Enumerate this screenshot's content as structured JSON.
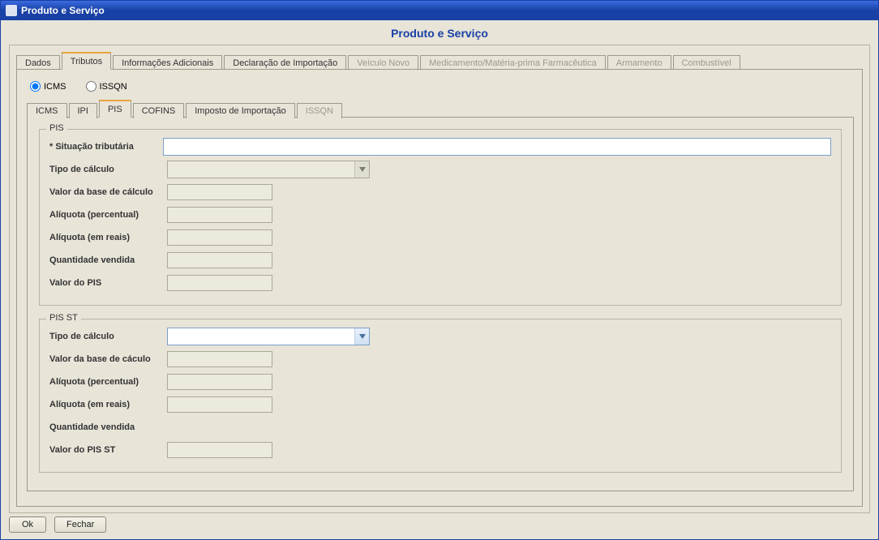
{
  "window": {
    "title": "Produto e Serviço"
  },
  "panel_title": "Produto e Serviço",
  "main_tabs": [
    {
      "label": "Dados",
      "selected": false,
      "disabled": false
    },
    {
      "label": "Tributos",
      "selected": true,
      "disabled": false
    },
    {
      "label": "Informações Adicionais",
      "selected": false,
      "disabled": false
    },
    {
      "label": "Declaração de Importação",
      "selected": false,
      "disabled": false
    },
    {
      "label": "Veículo Novo",
      "selected": false,
      "disabled": true
    },
    {
      "label": "Medicamento/Matéria-prima Farmacêutica",
      "selected": false,
      "disabled": true
    },
    {
      "label": "Armamento",
      "selected": false,
      "disabled": true
    },
    {
      "label": "Combustível",
      "selected": false,
      "disabled": true
    }
  ],
  "tax_type": {
    "icms_label": "ICMS",
    "issqn_label": "ISSQN",
    "selected": "ICMS"
  },
  "sub_tabs": [
    {
      "label": "ICMS",
      "selected": false,
      "disabled": false
    },
    {
      "label": "IPI",
      "selected": false,
      "disabled": false
    },
    {
      "label": "PIS",
      "selected": true,
      "disabled": false
    },
    {
      "label": "COFINS",
      "selected": false,
      "disabled": false
    },
    {
      "label": "Imposto de Importação",
      "selected": false,
      "disabled": false
    },
    {
      "label": "ISSQN",
      "selected": false,
      "disabled": true
    }
  ],
  "fieldsets": {
    "pis": {
      "legend": "PIS",
      "fields": {
        "situacao_tributaria": {
          "label": "* Situação tributária",
          "value": ""
        },
        "tipo_calculo": {
          "label": "Tipo de cálculo",
          "value": ""
        },
        "valor_base": {
          "label": "Valor da base de cálculo",
          "value": ""
        },
        "aliquota_percentual": {
          "label": "Alíquota (percentual)",
          "value": ""
        },
        "aliquota_reais": {
          "label": "Alíquota (em reais)",
          "value": ""
        },
        "quantidade_vendida": {
          "label": "Quantidade vendida",
          "value": ""
        },
        "valor_pis": {
          "label": "Valor do PIS",
          "value": ""
        }
      }
    },
    "pis_st": {
      "legend": "PIS ST",
      "fields": {
        "tipo_calculo": {
          "label": "Tipo de cálculo",
          "value": ""
        },
        "valor_base": {
          "label": "Valor da base de cáculo",
          "value": ""
        },
        "aliquota_percentual": {
          "label": "Alíquota (percentual)",
          "value": ""
        },
        "aliquota_reais": {
          "label": "Alíquota (em reais)",
          "value": ""
        },
        "quantidade_vendida": {
          "label": "Quantidade vendida",
          "value": ""
        },
        "valor_pis_st": {
          "label": "Valor do PIS ST",
          "value": ""
        }
      }
    }
  },
  "buttons": {
    "ok": "Ok",
    "fechar": "Fechar"
  }
}
